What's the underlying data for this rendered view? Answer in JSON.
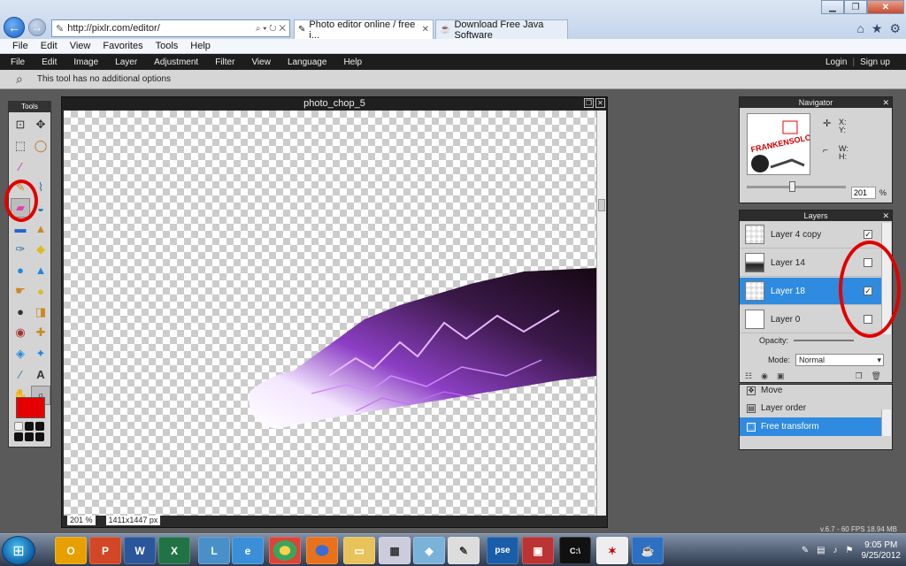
{
  "browser": {
    "address": "http://pixlr.com/editor/",
    "tabs": [
      {
        "label": "Photo editor online / free i..."
      },
      {
        "label": "Download Free Java Software"
      }
    ],
    "menu": [
      "File",
      "Edit",
      "View",
      "Favorites",
      "Tools",
      "Help"
    ]
  },
  "pixlr": {
    "menu": [
      "File",
      "Edit",
      "Image",
      "Layer",
      "Adjustment",
      "Filter",
      "View",
      "Language",
      "Help"
    ],
    "login": "Login",
    "signup": "Sign up",
    "option_text": "This tool has no additional options"
  },
  "tools_panel": {
    "title": "Tools",
    "tools": [
      "crop-icon",
      "move-icon",
      "marquee-icon",
      "lasso-icon",
      "wand-icon",
      "",
      "pencil-icon",
      "brush-icon",
      "eraser-icon",
      "paint-bucket-icon",
      "gradient-icon",
      "stamp-icon",
      "colorreplace-icon",
      "drawing-icon",
      "blur-icon",
      "sharpen-icon",
      "smudge-icon",
      "sponge-icon",
      "dodge-icon",
      "burn-icon",
      "redeye-icon",
      "spot-heal-icon",
      "bloat-icon",
      "pinch-icon",
      "picker-icon",
      "type-icon",
      "hand-icon",
      "zoom-icon"
    ],
    "primary_color": "#e40000"
  },
  "canvas": {
    "title": "photo_chop_5",
    "zoom": "201 %",
    "dimensions": "1411x1447 px"
  },
  "navigator": {
    "title": "Navigator",
    "x_label": "X:",
    "y_label": "Y:",
    "w_label": "W:",
    "h_label": "H:",
    "zoom_value": "201",
    "zoom_unit": "%"
  },
  "layers": {
    "title": "Layers",
    "items": [
      {
        "name": "Layer 4 copy",
        "checked": true,
        "selected": false
      },
      {
        "name": "Layer 14",
        "checked": false,
        "selected": false
      },
      {
        "name": "Layer 18",
        "checked": true,
        "selected": true
      },
      {
        "name": "Layer 0",
        "checked": false,
        "selected": false
      }
    ],
    "opacity_label": "Opacity:",
    "mode_label": "Mode:",
    "mode_value": "Normal"
  },
  "history": {
    "items": [
      {
        "label": "Move",
        "selected": false
      },
      {
        "label": "Layer order",
        "selected": false
      },
      {
        "label": "Free transform",
        "selected": true
      }
    ]
  },
  "version": "v.6.7 - 60 FPS 18.94 MB",
  "taskbar": {
    "apps": [
      "O",
      "P",
      "W",
      "X",
      "L",
      "e",
      "chrome",
      "firefox",
      "folder",
      "calc",
      "cube",
      "paint",
      "pse",
      "cmd",
      "spy",
      "java"
    ],
    "time": "9:05 PM",
    "date": "9/25/2012"
  }
}
